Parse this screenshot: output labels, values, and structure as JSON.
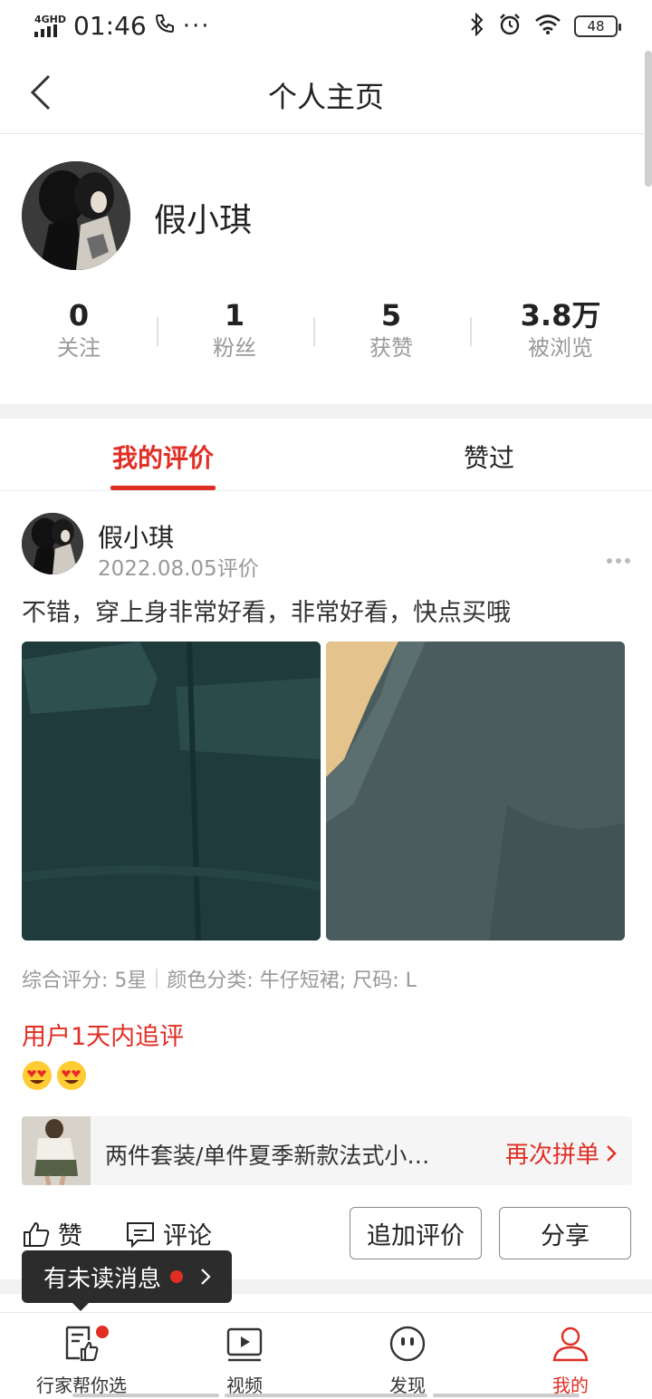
{
  "status_bar": {
    "network": "4GHD",
    "time": "01:46",
    "battery": "48"
  },
  "nav": {
    "title": "个人主页"
  },
  "profile": {
    "name": "假小琪",
    "stats": [
      {
        "num": "0",
        "label": "关注"
      },
      {
        "num": "1",
        "label": "粉丝"
      },
      {
        "num": "5",
        "label": "获赞"
      },
      {
        "num": "3.8万",
        "label": "被浏览"
      }
    ]
  },
  "tabs": {
    "active": "我的评价",
    "other": "赞过"
  },
  "review": {
    "name": "假小琪",
    "date": "2022.08.05评价",
    "text": "不错，穿上身非常好看，非常好看，快点买哦",
    "meta_rating": "综合评分: 5星",
    "meta_sku": "颜色分类: 牛仔短裙; 尺码: L",
    "followup_label": "用户1天内追评",
    "followup_emojis": [
      "😍",
      "😍"
    ],
    "product": {
      "title": "两件套装/单件夏季新款法式小…",
      "action": "再次拼单"
    },
    "like_label": "赞",
    "comment_label": "评论",
    "add_review_label": "追加评价",
    "share_label": "分享"
  },
  "toast": {
    "text": "有未读消息"
  },
  "tabbar": [
    {
      "label": "行家帮你选",
      "icon": "recommend-icon"
    },
    {
      "label": "视频",
      "icon": "video-icon"
    },
    {
      "label": "发现",
      "icon": "discover-icon"
    },
    {
      "label": "我的",
      "icon": "profile-icon"
    }
  ],
  "colors": {
    "accent": "#e02e24",
    "muted": "#999999"
  }
}
